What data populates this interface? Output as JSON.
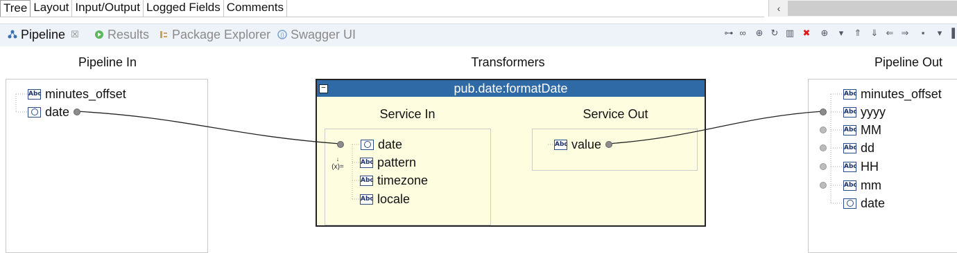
{
  "top_tabs": [
    "Tree",
    "Layout",
    "Input/Output",
    "Logged Fields",
    "Comments"
  ],
  "scroll_left_glyph": "‹",
  "views": {
    "pipeline": "Pipeline",
    "close_glyph": "☒",
    "results": "Results",
    "package_explorer": "Package Explorer",
    "swagger": "Swagger UI"
  },
  "toolbar_glyphs": [
    "⊶",
    "∞",
    "⊕",
    "↻",
    "▥",
    "✖",
    "⊕",
    "▾",
    "⇑",
    "⇓",
    "⇐",
    "⇒",
    "▪",
    "▾",
    "▌"
  ],
  "toolbar_names": [
    "link-icon",
    "chain-icon",
    "map-icon",
    "rotate-icon",
    "grid-icon",
    "delete-icon",
    "transformer-icon",
    "dropdown-icon",
    "move-up-icon",
    "move-down-icon",
    "move-left-icon",
    "move-right-icon",
    "layout-icon",
    "dropdown-icon",
    "panel-icon"
  ],
  "colors": {
    "title_bar": "#2f6aa7",
    "transformer_bg": "#fffde0",
    "delete": "#d91a1a"
  },
  "headers": {
    "pipeline_in": "Pipeline In",
    "transformers": "Transformers",
    "pipeline_out": "Pipeline Out"
  },
  "pipeline_in": [
    {
      "name": "minutes_offset",
      "type": "string"
    },
    {
      "name": "date",
      "type": "date"
    }
  ],
  "transformer": {
    "title": "pub.date:formatDate",
    "collapse_glyph": "−",
    "service_in_label": "Service In",
    "service_out_label": "Service Out",
    "service_in": [
      {
        "name": "date",
        "type": "date"
      },
      {
        "name": "pattern",
        "type": "string"
      },
      {
        "name": "timezone",
        "type": "string"
      },
      {
        "name": "locale",
        "type": "string"
      }
    ],
    "service_out": [
      {
        "name": "value",
        "type": "string"
      }
    ],
    "set_value_icon_glyph": "(x)="
  },
  "pipeline_out": [
    {
      "name": "minutes_offset",
      "type": "string"
    },
    {
      "name": "yyyy",
      "type": "string"
    },
    {
      "name": "MM",
      "type": "string"
    },
    {
      "name": "dd",
      "type": "string"
    },
    {
      "name": "HH",
      "type": "string"
    },
    {
      "name": "mm",
      "type": "string"
    },
    {
      "name": "date",
      "type": "date"
    }
  ],
  "type_icon_text": {
    "string": "Abc"
  }
}
